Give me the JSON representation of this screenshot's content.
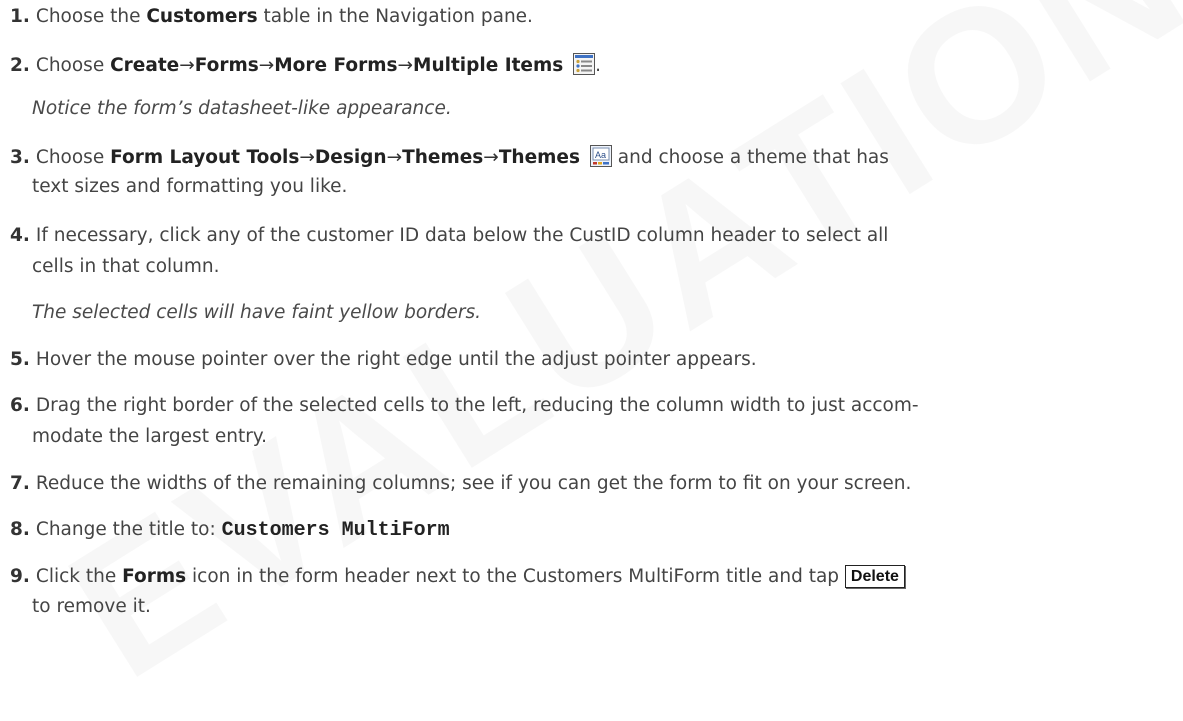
{
  "watermark": {
    "text": "EVALUATION"
  },
  "steps": [
    {
      "num": "1.",
      "pre": "Choose the ",
      "bold": "Customers",
      "post": " table in the Navigation pane."
    },
    {
      "num": "2.",
      "pre": "Choose ",
      "p1": "Create",
      "p2": "Forms",
      "p3": "More Forms",
      "p4": "Multiple Items",
      "post": ".",
      "icon": "multiple-items-icon"
    },
    {
      "note": "Notice the form’s datasheet-like appearance."
    },
    {
      "num": "3.",
      "pre": "Choose ",
      "p1": "Form Layout Tools",
      "p2": "Design",
      "p3": "Themes",
      "p4": "Themes",
      "post": " and choose a theme that has",
      "cont": "text sizes and formatting you like.",
      "icon": "themes-icon"
    },
    {
      "num": "4.",
      "text": "If necessary, click any of the customer ID data below the CustID column header to select all",
      "cont": "cells in that column."
    },
    {
      "note": "The selected cells will have faint yellow borders."
    },
    {
      "num": "5.",
      "text": "Hover the mouse pointer over the right edge until the adjust pointer appears."
    },
    {
      "num": "6.",
      "text": "Drag the right border of the selected cells to the left, reducing the column width to just accom-",
      "cont": "modate the largest entry."
    },
    {
      "num": "7.",
      "text": "Reduce the widths of the remaining columns; see if you can get the form to fit on your screen."
    },
    {
      "num": "8.",
      "pre": "Change the title to: ",
      "code": "Customers MultiForm"
    },
    {
      "num": "9.",
      "pre": "Click the ",
      "bold": "Forms",
      "mid": " icon in the form header next to the Customers MultiForm title and tap ",
      "key": "Delete",
      "cont": "to remove it."
    }
  ],
  "arrow": "→"
}
